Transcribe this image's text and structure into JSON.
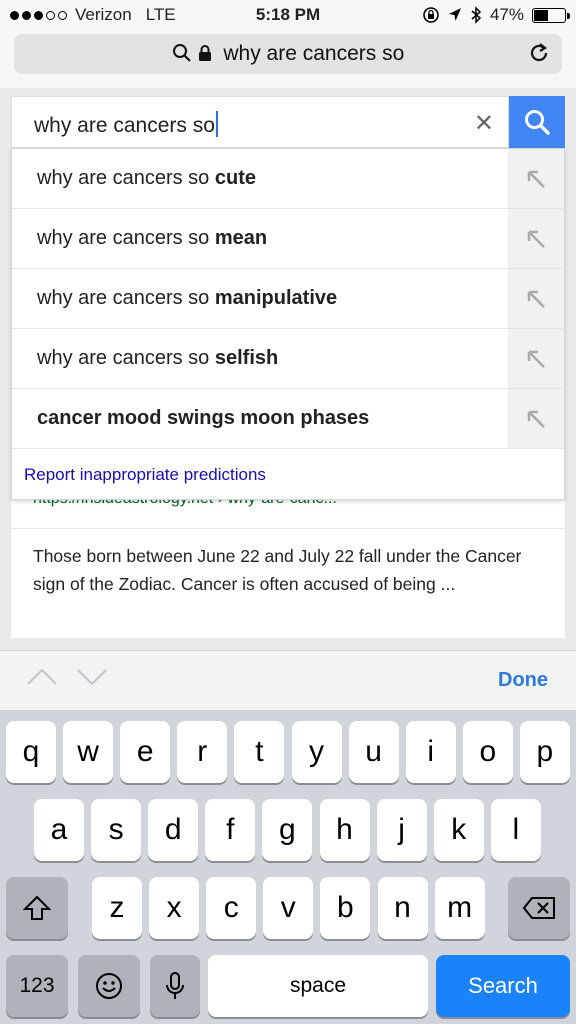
{
  "status_bar": {
    "carrier": "Verizon",
    "network": "LTE",
    "time": "5:18 PM",
    "battery": "47%"
  },
  "url_bar": {
    "text": "why are cancers so"
  },
  "search": {
    "query": "why are cancers so"
  },
  "suggestions": [
    {
      "prefix": "why are cancers so ",
      "bold": "cute"
    },
    {
      "prefix": "why are cancers so ",
      "bold": "mean"
    },
    {
      "prefix": "why are cancers so ",
      "bold": "manipulative"
    },
    {
      "prefix": "why are cancers so ",
      "bold": "selfish"
    },
    {
      "prefix": "",
      "bold": "cancer mood swings moon phases"
    }
  ],
  "report_link": "Report inappropriate predictions",
  "result": {
    "url": "https://insideastrology.net › why-are-canc...",
    "snippet": "Those born between June 22 and July 22 fall under the Cancer sign of the Zodiac. Cancer is often accused of being ..."
  },
  "accessory": {
    "done_label": "Done"
  },
  "keyboard": {
    "row1": [
      "q",
      "w",
      "e",
      "r",
      "t",
      "y",
      "u",
      "i",
      "o",
      "p"
    ],
    "row2": [
      "a",
      "s",
      "d",
      "f",
      "g",
      "h",
      "j",
      "k",
      "l"
    ],
    "row3": [
      "z",
      "x",
      "c",
      "v",
      "b",
      "n",
      "m"
    ],
    "numbers_label": "123",
    "space_label": "space",
    "search_label": "Search"
  },
  "colors": {
    "accent": "#4285f4",
    "link": "#1a0dab",
    "url_green": "#006621",
    "search_key": "#1a82fb",
    "done": "#2f7bd9"
  }
}
